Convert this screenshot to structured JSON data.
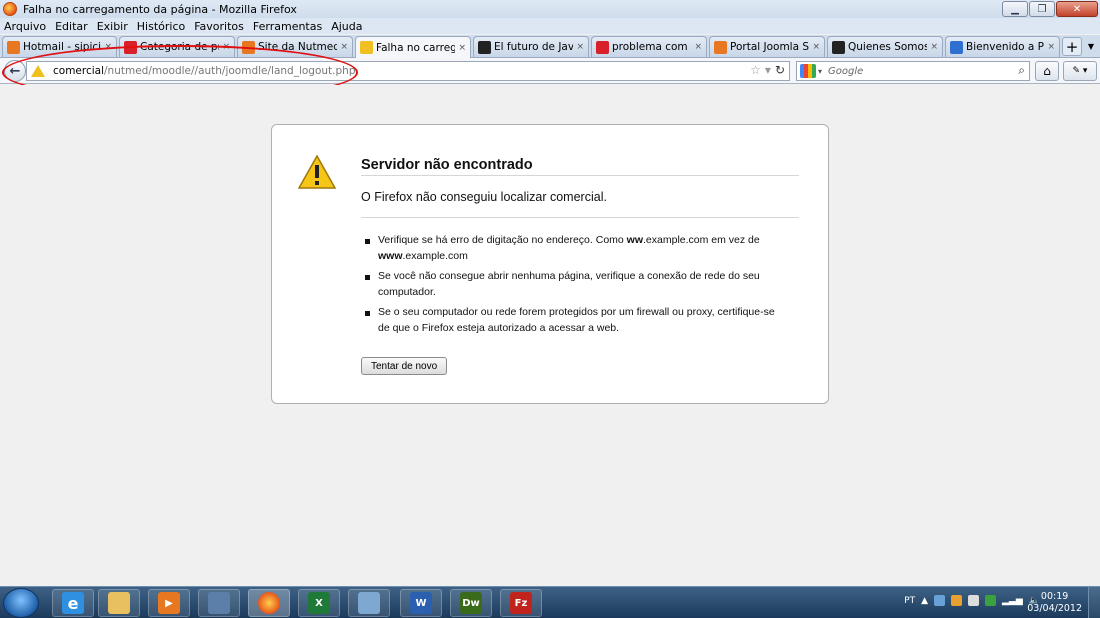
{
  "window": {
    "title": "Falha no carregamento da página - Mozilla Firefox"
  },
  "menu": [
    "Arquivo",
    "Editar",
    "Exibir",
    "Histórico",
    "Favoritos",
    "Ferramentas",
    "Ajuda"
  ],
  "tabs": [
    {
      "label": "Hotmail - sipicius...",
      "icon_color": "#e87722"
    },
    {
      "label": "Categoria de pro...",
      "icon_color": "#d8202a"
    },
    {
      "label": "Site da Nutmed - ...",
      "icon_color": "#e87722"
    },
    {
      "label": "Falha no carrega...",
      "icon_color": "#f0c020",
      "active": true
    },
    {
      "label": "El futuro de Javas...",
      "icon_color": "#222222"
    },
    {
      "label": "problema com m...",
      "icon_color": "#d8202a"
    },
    {
      "label": "Portal Joomla Spa...",
      "icon_color": "#e87722"
    },
    {
      "label": "Quienes Somos ?",
      "icon_color": "#222222"
    },
    {
      "label": "Bienvenido a Pixe...",
      "icon_color": "#2f6fd0"
    }
  ],
  "tab_close_glyph": "×",
  "newtab_glyph": "+",
  "urlbar": {
    "host": "comercial",
    "path": "/nutmed/moodle//auth/joomdle/land_logout.php"
  },
  "search": {
    "placeholder": "Google"
  },
  "error": {
    "title": "Servidor não encontrado",
    "description": "O Firefox não conseguiu localizar comercial.",
    "bullet1_a": "Verifique se há erro de digitação no endereço. Como ",
    "bullet1_b1": "ww",
    "bullet1_c": ".example.com em vez de ",
    "bullet1_b2": "www",
    "bullet1_d": ".example.com",
    "bullet2": "Se você não consegue abrir nenhuma página, verifique a conexão de rede do seu computador.",
    "bullet3": "Se o seu computador ou rede forem protegidos por um firewall ou proxy, certifique-se de que o Firefox esteja autorizado a acessar a web.",
    "retry_label": "Tentar de novo"
  },
  "taskbar": {
    "apps": [
      {
        "name": "internet-explorer",
        "glyph": "e",
        "color": "#2f8fe0"
      },
      {
        "name": "windows-explorer",
        "glyph": "",
        "color": "#e8c060"
      },
      {
        "name": "media-player",
        "glyph": "▶",
        "color": "#e87722"
      },
      {
        "name": "tools",
        "glyph": "",
        "color": "#5b7fa8"
      },
      {
        "name": "firefox",
        "glyph": "",
        "color": "#e8561b"
      },
      {
        "name": "excel",
        "glyph": "X",
        "color": "#1f7a3a"
      },
      {
        "name": "notepad",
        "glyph": "",
        "color": "#7fa8d0"
      },
      {
        "name": "word",
        "glyph": "W",
        "color": "#2b5fb0"
      },
      {
        "name": "dreamweaver",
        "glyph": "Dw",
        "color": "#3a6b1a"
      },
      {
        "name": "filezilla",
        "glyph": "Fz",
        "color": "#c0241c"
      }
    ],
    "lang": "PT",
    "time": "00:19",
    "date": "03/04/2012"
  }
}
